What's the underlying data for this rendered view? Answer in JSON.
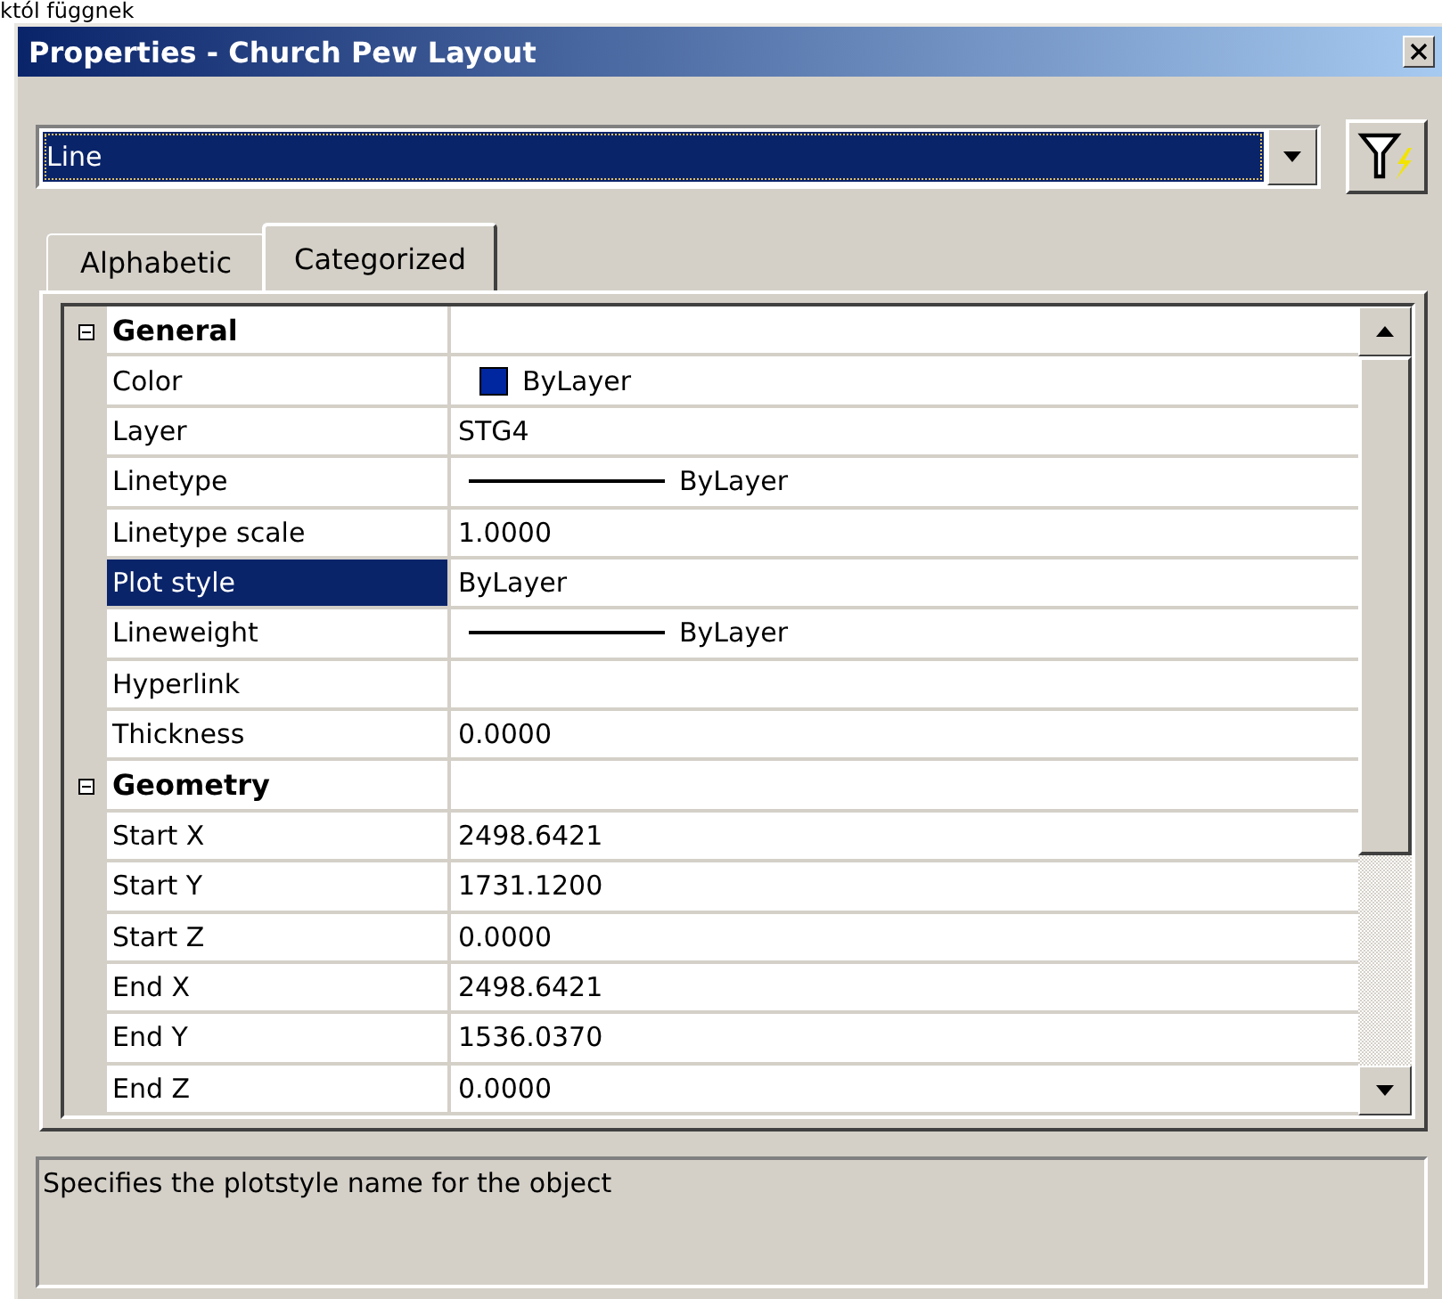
{
  "background_text": "któl függnek",
  "window": {
    "title": "Properties - Church Pew Layout"
  },
  "object_select": {
    "value": "Line"
  },
  "tabs": [
    {
      "label": "Alphabetic",
      "selected": false
    },
    {
      "label": "Categorized",
      "selected": true
    }
  ],
  "grid": {
    "rows": [
      {
        "kind": "category",
        "name": "General",
        "expanded": true
      },
      {
        "kind": "color",
        "name": "Color",
        "value": "ByLayer",
        "color": "#0026a0",
        "selected": false
      },
      {
        "kind": "text",
        "name": "Layer",
        "value": "STG4",
        "selected": false
      },
      {
        "kind": "line",
        "name": "Linetype",
        "value": "ByLayer",
        "selected": false
      },
      {
        "kind": "text",
        "name": "Linetype scale",
        "value": "1.0000",
        "selected": false
      },
      {
        "kind": "text",
        "name": "Plot style",
        "value": "ByLayer",
        "selected": true
      },
      {
        "kind": "line",
        "name": "Lineweight",
        "value": "ByLayer",
        "selected": false
      },
      {
        "kind": "text",
        "name": "Hyperlink",
        "selected": false
      },
      {
        "kind": "text",
        "name": "Thickness",
        "value": "0.0000",
        "selected": false
      },
      {
        "kind": "category",
        "name": "Geometry",
        "expanded": true
      },
      {
        "kind": "text",
        "name": "Start X",
        "value": "2498.6421",
        "selected": false
      },
      {
        "kind": "text",
        "name": "Start Y",
        "value": "1731.1200",
        "selected": false
      },
      {
        "kind": "text",
        "name": "Start Z",
        "value": "0.0000",
        "selected": false
      },
      {
        "kind": "text",
        "name": "End X",
        "value": "2498.6421",
        "selected": false
      },
      {
        "kind": "text",
        "name": "End Y",
        "value": "1536.0370",
        "selected": false
      },
      {
        "kind": "text",
        "name": "End Z",
        "value": "0.0000",
        "selected": false
      }
    ]
  },
  "description": "Specifies the plotstyle name for the object"
}
